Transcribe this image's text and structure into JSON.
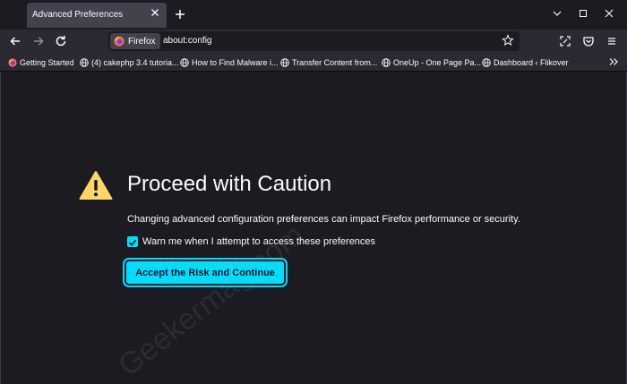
{
  "tab": {
    "title": "Advanced Preferences"
  },
  "urlbar": {
    "identity_label": "Firefox",
    "url": "about:config"
  },
  "bookmarks": [
    {
      "label": "Getting Started",
      "icon": "firefox-icon"
    },
    {
      "label": "(4) cakephp 3.4 tutoria...",
      "icon": "globe-icon"
    },
    {
      "label": "How to Find Malware i...",
      "icon": "globe-icon"
    },
    {
      "label": "Transfer Content from...",
      "icon": "globe-icon"
    },
    {
      "label": "OneUp - One Page Pa...",
      "icon": "globe-icon"
    },
    {
      "label": "Dashboard ‹ Flikover",
      "icon": "globe-icon"
    }
  ],
  "warning": {
    "title": "Proceed with Caution",
    "description": "Changing advanced configuration preferences can impact Firefox performance or security.",
    "checkbox_label": "Warn me when I attempt to access these preferences",
    "checkbox_checked": true,
    "button_label": "Accept the Risk and Continue"
  },
  "watermark": "Geekermag.com",
  "colors": {
    "accent": "#00ddff",
    "warning": "#ffd567",
    "background": "#1c1b22",
    "toolbar": "#2b2a33"
  }
}
